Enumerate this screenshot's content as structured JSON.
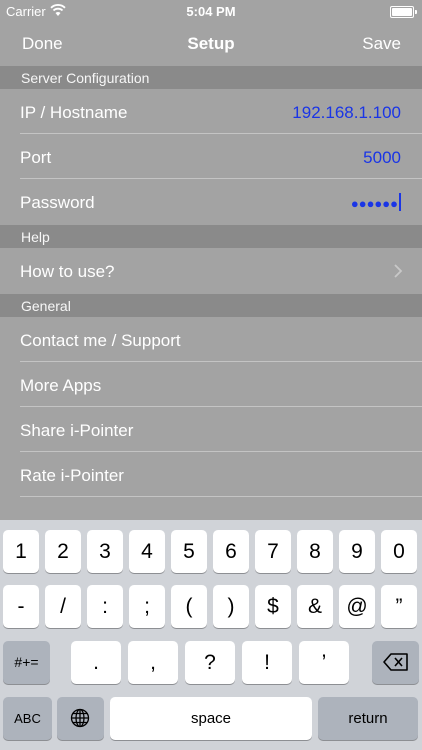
{
  "status": {
    "carrier": "Carrier",
    "time": "5:04 PM"
  },
  "nav": {
    "left": "Done",
    "title": "Setup",
    "right": "Save"
  },
  "sections": {
    "server": "Server Configuration",
    "help": "Help",
    "general": "General"
  },
  "server": {
    "ip_label": "IP / Hostname",
    "ip_value": "192.168.1.100",
    "port_label": "Port",
    "port_value": "5000",
    "password_label": "Password",
    "password_value": "●●●●●●"
  },
  "help": {
    "how_to": "How to use?"
  },
  "general": {
    "contact": "Contact me / Support",
    "more_apps": "More Apps",
    "share": "Share i-Pointer",
    "rate": "Rate i-Pointer"
  },
  "keyboard": {
    "row1": [
      "1",
      "2",
      "3",
      "4",
      "5",
      "6",
      "7",
      "8",
      "9",
      "0"
    ],
    "row2": [
      "-",
      "/",
      ":",
      ";",
      "(",
      ")",
      "$",
      "&",
      "@",
      "”"
    ],
    "row3_mode": "#+=",
    "row3": [
      ".",
      ",",
      "?",
      "!",
      "’"
    ],
    "abc": "ABC",
    "space": "space",
    "return": "return"
  },
  "colors": {
    "accent": "#1a35e6",
    "background": "#a3a3a3",
    "section": "#8a8a8a"
  },
  "icons": {
    "wifi": "wifi-icon",
    "battery": "battery-icon",
    "chevron": "chevron-right-icon",
    "globe": "globe-icon",
    "backspace": "backspace-icon"
  }
}
